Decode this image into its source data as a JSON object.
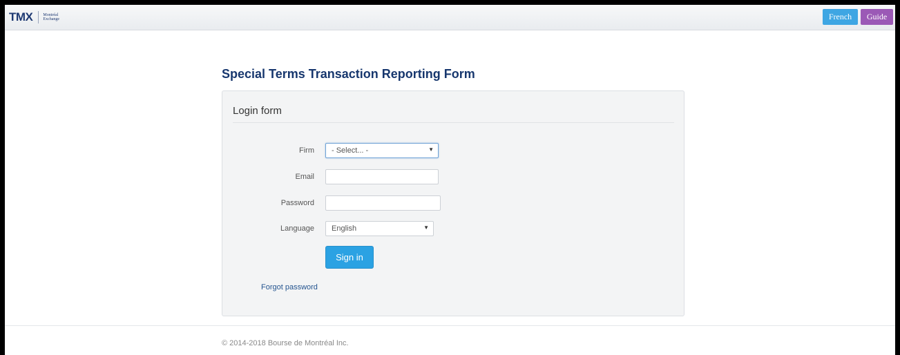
{
  "header": {
    "logo_text": "TMX",
    "logo_sub_line1": "Montréal",
    "logo_sub_line2": "Exchange",
    "french_label": "French",
    "guide_label": "Guide"
  },
  "main": {
    "title": "Special Terms Transaction Reporting Form",
    "panel_title": "Login form",
    "fields": {
      "firm_label": "Firm",
      "firm_value": "- Select... -",
      "email_label": "Email",
      "email_value": "",
      "password_label": "Password",
      "password_value": "",
      "language_label": "Language",
      "language_value": "English"
    },
    "signin_label": "Sign in",
    "forgot_label": "Forgot password"
  },
  "footer": {
    "copyright": "© 2014-2018 Bourse de Montréal Inc."
  },
  "icons": {
    "select_caret": "▼"
  },
  "colors": {
    "french_button": "#3ea6e3",
    "guide_button": "#9b59b6",
    "signin_button": "#2ba2e3",
    "title": "#17376e"
  }
}
